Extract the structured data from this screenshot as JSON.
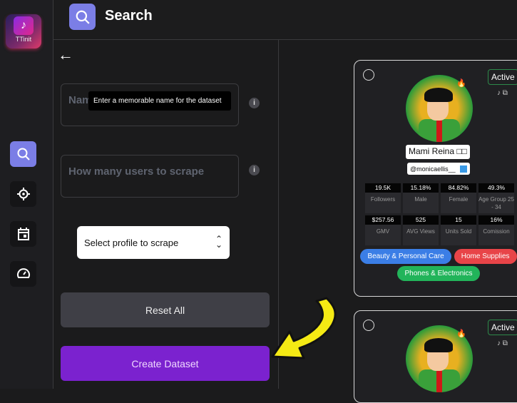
{
  "app": {
    "logo_text": "TTinit",
    "logo_glyph": "♪"
  },
  "header": {
    "title": "Search"
  },
  "sidebar": {
    "items": [
      {
        "name": "search",
        "icon": "search-icon",
        "active": true
      },
      {
        "name": "target",
        "icon": "crosshair-icon",
        "active": false
      },
      {
        "name": "calendar",
        "icon": "calendar-icon",
        "active": false
      },
      {
        "name": "dashboard",
        "icon": "speedometer-icon",
        "active": false
      }
    ]
  },
  "form": {
    "back_glyph": "←",
    "name_placeholder": "Nam",
    "name_tooltip": "Enter a memorable name for the dataset",
    "users_placeholder": "How many users to scrape",
    "info_glyph": "i",
    "select_value": "Select profile to scrape",
    "select_arrow": "⌃⌄",
    "reset_label": "Reset All",
    "create_label": "Create Dataset"
  },
  "cards": [
    {
      "status": "Active",
      "links": "♪ ⧉",
      "fire": "🔥",
      "name": "Mami Reina □□",
      "handle": "@monicaellis__",
      "stats": [
        {
          "value": "19.5K",
          "label": "Followers"
        },
        {
          "value": "15.18%",
          "label": "Male"
        },
        {
          "value": "84.82%",
          "label": "Female"
        },
        {
          "value": "49.3%",
          "label": "Age Group 25 - 34"
        },
        {
          "value": "$257.56",
          "label": "GMV"
        },
        {
          "value": "525",
          "label": "AVG Views"
        },
        {
          "value": "15",
          "label": "Units Sold"
        },
        {
          "value": "16%",
          "label": "Comission"
        }
      ],
      "tags": [
        {
          "label": "Beauty & Personal Care",
          "color": "#3b7ee6"
        },
        {
          "label": "Home Supplies",
          "color": "#e84448"
        },
        {
          "label": "Phones & Electronics",
          "color": "#22b45a"
        }
      ]
    },
    {
      "status": "Active",
      "links": "♪ ⧉",
      "fire": "🔥"
    }
  ],
  "colors": {
    "accent": "#7b7ee6",
    "create": "#7b22cf",
    "reset": "#3f3f46",
    "annotation_arrow": "#f5ea14"
  }
}
